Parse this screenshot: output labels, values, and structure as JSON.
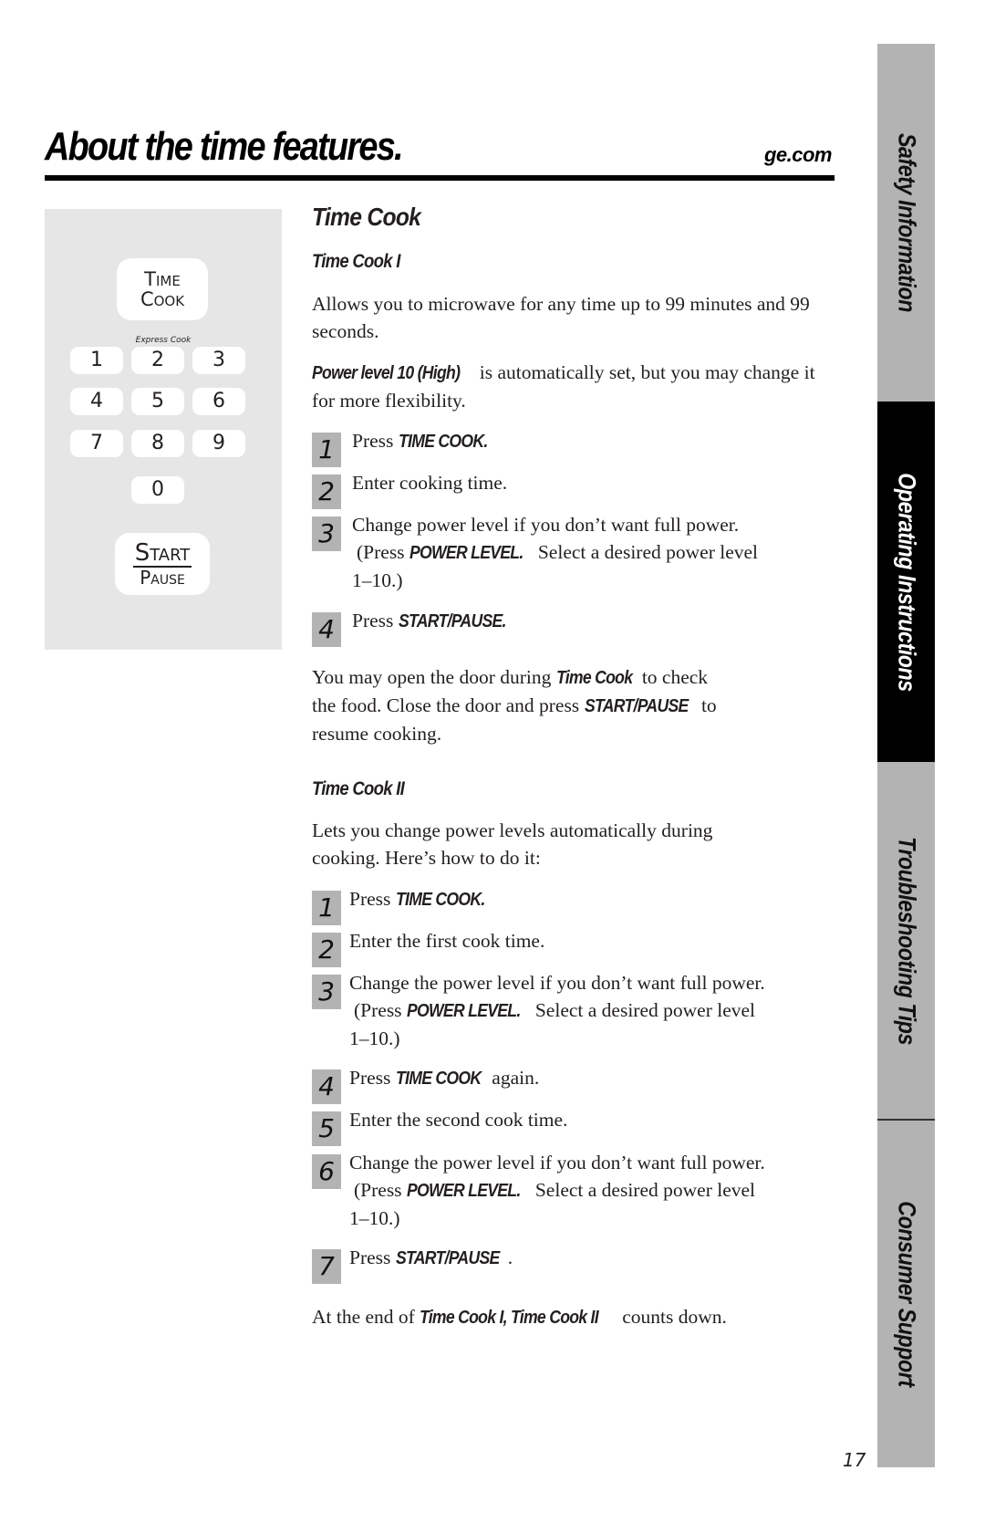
{
  "header": {
    "title": "About the time features.",
    "site": "ge.com"
  },
  "keypad": {
    "time_cook_line1": "Time",
    "time_cook_line2": "Cook",
    "express_cook_label": "Express Cook",
    "keys": [
      "1",
      "2",
      "3",
      "4",
      "5",
      "6",
      "7",
      "8",
      "9",
      "0"
    ],
    "start_label": "Start",
    "pause_label": "Pause"
  },
  "section": {
    "title": "Time Cook",
    "time_cook_1": {
      "heading": "Time Cook I",
      "intro": "Allows you to microwave for any time up to 99 minutes and 99 seconds.",
      "power_bold": "Power level 10 (High)",
      "power_rest": " is automatically set, but you may change it for more flexibility.",
      "steps": [
        {
          "num": "1",
          "pre": "Press ",
          "bold": "TIME COOK.",
          "post": ""
        },
        {
          "num": "2",
          "pre": "Enter cooking time.",
          "bold": "",
          "post": ""
        },
        {
          "num": "3",
          "pre": "Change power level if you don’t want full power.",
          "sub_pre": "(Press ",
          "bold": "POWER LEVEL.",
          "post": " Select a desired power level",
          "tail": "1–10.)"
        },
        {
          "num": "4",
          "pre": "Press ",
          "bold": "START/PAUSE.",
          "post": ""
        }
      ],
      "note_1": "You may open the door during ",
      "note_bold_1": "Time Cook",
      "note_2": " to check",
      "note_3": "the food. Close the door and press ",
      "note_bold_2": "START/PAUSE",
      "note_4": " to",
      "note_5": "resume cooking."
    },
    "time_cook_2": {
      "heading": "Time Cook II",
      "intro_line1": "Lets you change power levels automatically during",
      "intro_line2": "cooking. Here’s how to do it:",
      "steps": [
        {
          "num": "1",
          "pre": "Press ",
          "bold": "TIME COOK.",
          "post": ""
        },
        {
          "num": "2",
          "pre": "Enter the first cook time.",
          "bold": "",
          "post": ""
        },
        {
          "num": "3",
          "pre": "Change the power level if you don’t want full power.",
          "sub_pre": "(Press ",
          "bold": "POWER LEVEL.",
          "post": " Select a desired power level",
          "tail": "1–10.)"
        },
        {
          "num": "4",
          "pre": "Press ",
          "bold": "TIME COOK",
          "post": " again."
        },
        {
          "num": "5",
          "pre": "Enter the second cook time.",
          "bold": "",
          "post": ""
        },
        {
          "num": "6",
          "pre": "Change the power level if you don’t want full power.",
          "sub_pre": "(Press ",
          "bold": "POWER LEVEL.",
          "post": " Select a desired power level",
          "tail": "1–10.)"
        },
        {
          "num": "7",
          "pre": "Press ",
          "bold": "START/PAUSE",
          "post": "."
        }
      ],
      "footer_pre": "At the end of ",
      "footer_bold": "Time Cook I, Time Cook II",
      "footer_post": " counts down."
    }
  },
  "side_tabs": [
    {
      "label": "Safety Information",
      "active": false
    },
    {
      "label": "Operating Instructions",
      "active": true
    },
    {
      "label": "Troubleshooting Tips",
      "active": false
    },
    {
      "label": "Consumer Support",
      "active": false
    }
  ],
  "page_number": "17",
  "colors": {
    "tab_gray": "#b3b3b3",
    "tab_active": "#000000",
    "panel_gray": "#e6e6e6",
    "step_box": "#b3b3b3"
  }
}
